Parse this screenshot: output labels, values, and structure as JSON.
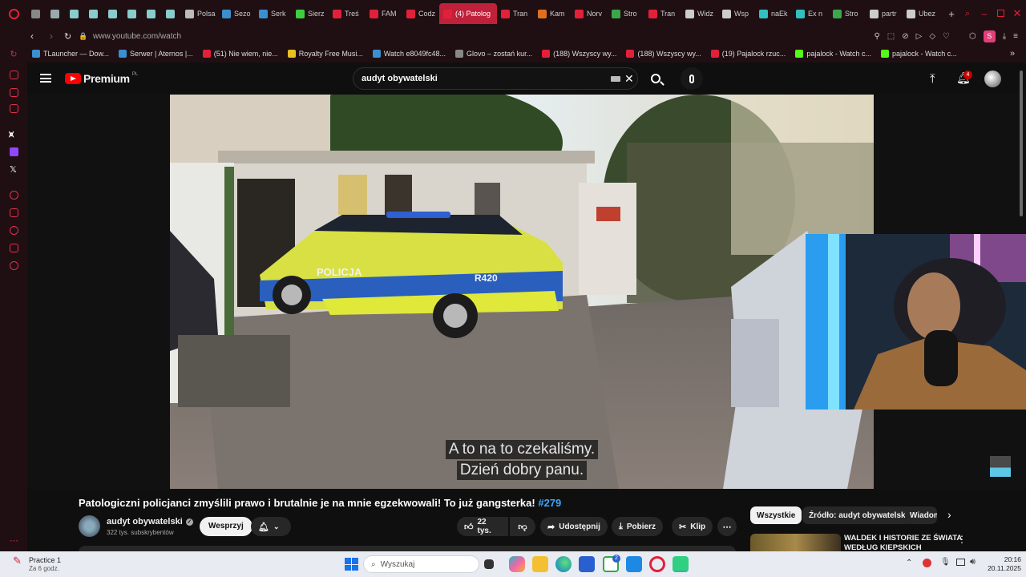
{
  "browser": {
    "tabs": [
      {
        "label": "",
        "color": "#888"
      },
      {
        "label": "",
        "color": "#9aa"
      },
      {
        "label": "",
        "color": "#8cc"
      },
      {
        "label": "",
        "color": "#8cc"
      },
      {
        "label": "",
        "color": "#8cc"
      },
      {
        "label": "",
        "color": "#8cc"
      },
      {
        "label": "",
        "color": "#8cc"
      },
      {
        "label": "",
        "color": "#8cc"
      },
      {
        "label": "Polsa",
        "color": "#bbb"
      },
      {
        "label": "Sezo",
        "color": "#3a8fd0"
      },
      {
        "label": "Serk",
        "color": "#3a8fd0"
      },
      {
        "label": "Sierz",
        "color": "#3ecf3e"
      },
      {
        "label": "Treś",
        "color": "#e3203a"
      },
      {
        "label": "FAM",
        "color": "#e3203a"
      },
      {
        "label": "Codz",
        "color": "#e3203a"
      },
      {
        "label": "(4) Patolog",
        "color": "#e3203a",
        "active": true
      },
      {
        "label": "Tran",
        "color": "#e3203a"
      },
      {
        "label": "Kam",
        "color": "#e07020"
      },
      {
        "label": "Norv",
        "color": "#e3203a"
      },
      {
        "label": "Stro",
        "color": "#3aa84a"
      },
      {
        "label": "Tran",
        "color": "#e3203a"
      },
      {
        "label": "Widz",
        "color": "#ccc"
      },
      {
        "label": "Wsp",
        "color": "#ccc"
      },
      {
        "label": "naEk",
        "color": "#30c0c0"
      },
      {
        "label": "Ex n",
        "color": "#30c0c0"
      },
      {
        "label": "Stro",
        "color": "#3aa84a"
      },
      {
        "label": "partr",
        "color": "#ccc"
      },
      {
        "label": "Ubez",
        "color": "#ccc"
      }
    ],
    "url": "www.youtube.com/watch",
    "bookmarks": [
      {
        "label": "TLauncher — Dow...",
        "color": "#3a8fd0"
      },
      {
        "label": "Serwer | Aternos |...",
        "color": "#3a8fd0"
      },
      {
        "label": "(51) Nie wiem, nie...",
        "color": "#e3203a"
      },
      {
        "label": "Royalty Free Musi...",
        "color": "#e8c020"
      },
      {
        "label": "Watch e8049fc48...",
        "color": "#3a8fd0"
      },
      {
        "label": "Glovo – zostań kur...",
        "color": "#888"
      },
      {
        "label": "(188) Wszyscy wy...",
        "color": "#e3203a"
      },
      {
        "label": "(188) Wszyscy wy...",
        "color": "#e3203a"
      },
      {
        "label": "(19) Pajalock rzuc...",
        "color": "#e3203a"
      },
      {
        "label": "pajalock - Watch c...",
        "color": "#53fc18"
      },
      {
        "label": "pajalock - Watch c...",
        "color": "#53fc18"
      }
    ],
    "profile_letter": "S"
  },
  "youtube": {
    "logo_text": "Premium",
    "region": "PL",
    "search_value": "audyt obywatelski",
    "notif_count": "4"
  },
  "video": {
    "subtitle_line1": "A to na to czekaliśmy.",
    "subtitle_line2": "Dzień dobry panu.",
    "car_text": "POLICJA",
    "car_plate": "R420"
  },
  "info": {
    "title": "Patologiczni policjanci zmyślili prawo i brutalnie je na mnie egzekwowali! To już gangsterka!",
    "hashtag": "#279",
    "channel": "audyt obywatelski",
    "subscribers": "322 tys. subskrybentów",
    "support_label": "Wesprzyj",
    "likes": "22 tys.",
    "share_label": "Udostępnij",
    "download_label": "Pobierz",
    "clip_label": "Klip"
  },
  "chips": [
    "Wszystkie",
    "Źródło: audyt obywatelski",
    "Wiadom"
  ],
  "rec": {
    "title_line1": "WALDEK I HISTORIE ZE ŚWIATA",
    "title_line2": "WEDŁUG KIEPSKICH"
  },
  "taskbar": {
    "app_title": "Practice 1",
    "app_sub": "Za 6 godz.",
    "search_placeholder": "Wyszukaj",
    "time": "20:16",
    "date": "20.11.2025",
    "store_badge": "2"
  },
  "colors": {
    "accent": "#e3203a",
    "yt_red": "#ff0000",
    "link_blue": "#3ea6ff"
  }
}
